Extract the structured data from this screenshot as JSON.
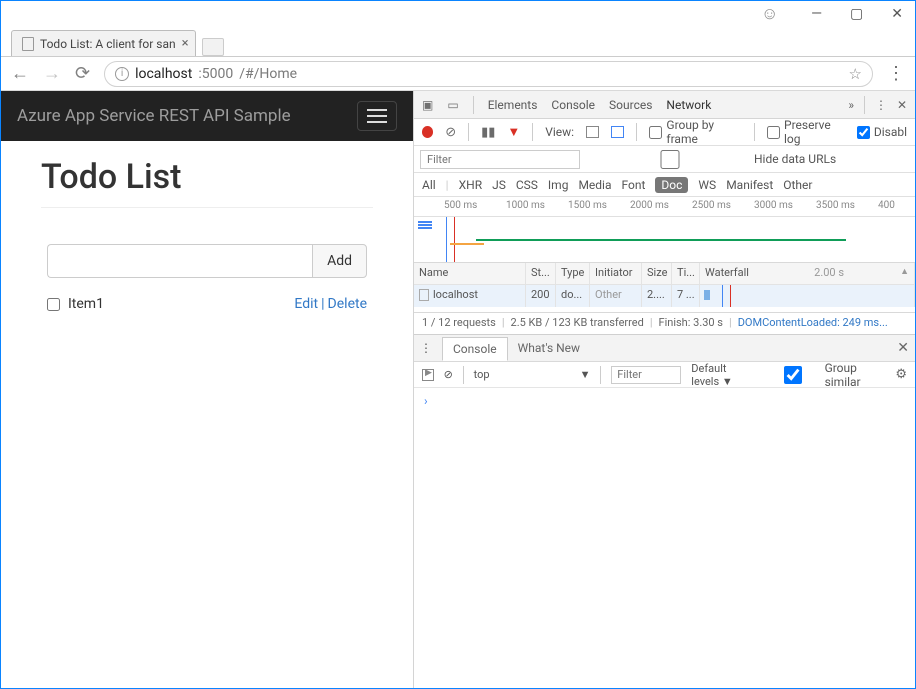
{
  "window": {
    "tab_title": "Todo List: A client for san"
  },
  "address": {
    "host": "localhost",
    "port": ":5000",
    "path": "/#/Home"
  },
  "app": {
    "brand": "Azure App Service REST API Sample",
    "heading": "Todo List",
    "add_label": "Add",
    "item_label": "Item1",
    "edit_label": "Edit",
    "delete_label": "Delete"
  },
  "devtools": {
    "tabs": {
      "elements": "Elements",
      "console": "Console",
      "sources": "Sources",
      "network": "Network"
    },
    "view_label": "View:",
    "group_by_frame": "Group by frame",
    "preserve_log": "Preserve log",
    "disable": "Disabl",
    "filter_placeholder": "Filter",
    "hide_data_urls": "Hide data URLs",
    "types": {
      "all": "All",
      "xhr": "XHR",
      "js": "JS",
      "css": "CSS",
      "img": "Img",
      "media": "Media",
      "font": "Font",
      "doc": "Doc",
      "ws": "WS",
      "manifest": "Manifest",
      "other": "Other"
    },
    "ruler": [
      "500 ms",
      "1000 ms",
      "1500 ms",
      "2000 ms",
      "2500 ms",
      "3000 ms",
      "3500 ms",
      "400"
    ],
    "cols": {
      "name": "Name",
      "status": "St...",
      "type": "Type",
      "initiator": "Initiator",
      "size": "Size",
      "time": "Ti...",
      "waterfall": "Waterfall",
      "wf_scale": "2.00 s"
    },
    "row": {
      "name": "localhost",
      "status": "200",
      "type": "do...",
      "initiator": "Other",
      "size": "2....",
      "time": "7 ..."
    },
    "status": {
      "requests": "1 / 12 requests",
      "transferred": "2.5 KB / 123 KB transferred",
      "finish": "Finish: 3.30 s",
      "dcl": "DOMContentLoaded: 249 ms..."
    },
    "drawer": {
      "console": "Console",
      "whatsnew": "What's New"
    },
    "console_bar": {
      "context": "top",
      "filter_placeholder": "Filter",
      "levels": "Default levels ▼",
      "group_similar": "Group similar"
    },
    "console_prompt": "›"
  }
}
